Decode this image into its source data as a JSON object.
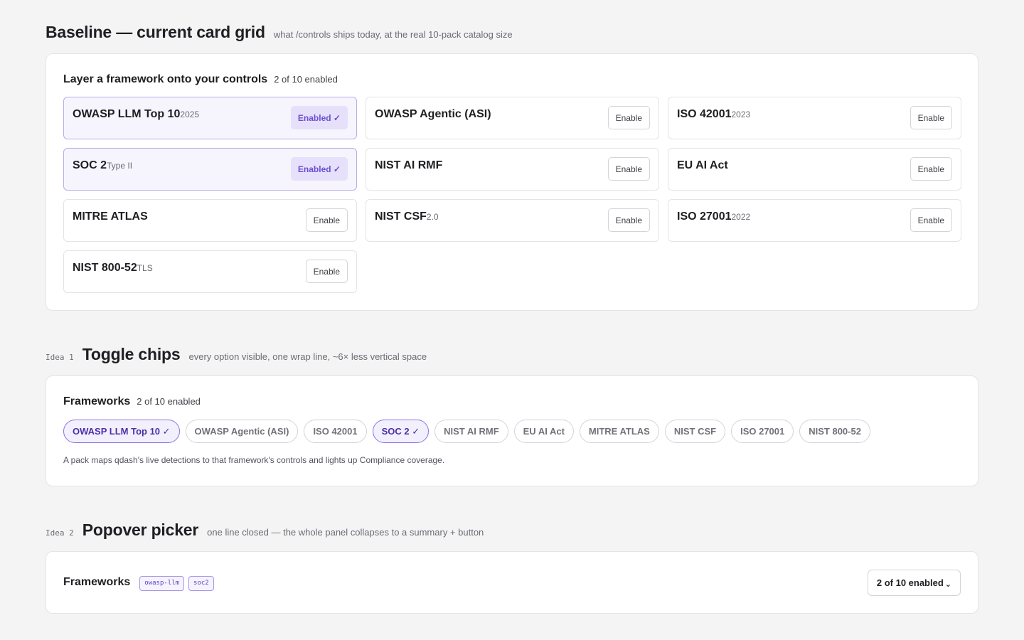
{
  "baseline": {
    "title": "Baseline — current card grid",
    "subtitle": "what /controls ships today, at the real 10-pack catalog size",
    "panel_title": "Layer a framework onto your controls",
    "panel_count": "2 of 10 enabled",
    "cards": [
      {
        "name": "OWASP LLM Top 10",
        "version": "2025",
        "button": "Enabled ✓",
        "enabled": true
      },
      {
        "name": "OWASP Agentic (ASI)",
        "version": "",
        "button": "Enable",
        "enabled": false
      },
      {
        "name": "ISO 42001",
        "version": "2023",
        "button": "Enable",
        "enabled": false
      },
      {
        "name": "SOC 2",
        "version": "Type II",
        "button": "Enabled ✓",
        "enabled": true
      },
      {
        "name": "NIST AI RMF",
        "version": "",
        "button": "Enable",
        "enabled": false
      },
      {
        "name": "EU AI Act",
        "version": "",
        "button": "Enable",
        "enabled": false
      },
      {
        "name": "MITRE ATLAS",
        "version": "",
        "button": "Enable",
        "enabled": false
      },
      {
        "name": "NIST CSF",
        "version": "2.0",
        "button": "Enable",
        "enabled": false
      },
      {
        "name": "ISO 27001",
        "version": "2022",
        "button": "Enable",
        "enabled": false
      },
      {
        "name": "NIST 800-52",
        "version": "TLS",
        "button": "Enable",
        "enabled": false
      }
    ]
  },
  "idea1": {
    "tag": "Idea 1",
    "title": "Toggle chips",
    "subtitle": "every option visible, one wrap line, ~6× less vertical space",
    "panel_title": "Frameworks",
    "panel_count": "2 of 10 enabled",
    "chips": [
      {
        "label": "OWASP LLM Top 10 ✓",
        "enabled": true
      },
      {
        "label": "OWASP Agentic (ASI)",
        "enabled": false
      },
      {
        "label": "ISO 42001",
        "enabled": false
      },
      {
        "label": "SOC 2 ✓",
        "enabled": true
      },
      {
        "label": "NIST AI RMF",
        "enabled": false
      },
      {
        "label": "EU AI Act",
        "enabled": false
      },
      {
        "label": "MITRE ATLAS",
        "enabled": false
      },
      {
        "label": "NIST CSF",
        "enabled": false
      },
      {
        "label": "ISO 27001",
        "enabled": false
      },
      {
        "label": "NIST 800-52",
        "enabled": false
      }
    ],
    "note": "A pack maps qdash's live detections to that framework's controls and lights up Compliance coverage."
  },
  "idea2": {
    "tag": "Idea 2",
    "title": "Popover picker",
    "subtitle": "one line closed — the whole panel collapses to a summary + button",
    "panel_title": "Frameworks",
    "tags": [
      "owasp-llm",
      "soc2"
    ],
    "button_label": "2 of 10 enabled",
    "button_caret": "⌄"
  },
  "colors": {
    "accent": "#6d4fd1",
    "accent_bg": "#e6e0fa",
    "background": "#f4f4f5"
  }
}
